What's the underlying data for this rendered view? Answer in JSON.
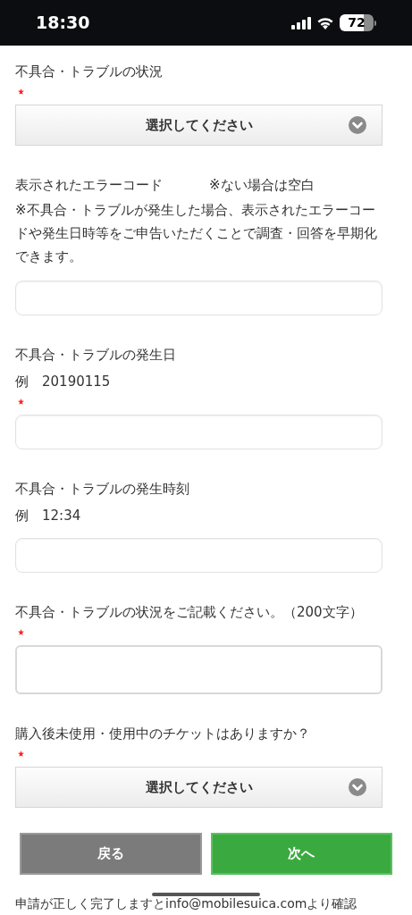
{
  "status_bar": {
    "time": "18:30",
    "battery": "72"
  },
  "fields": [
    {
      "kind": "select",
      "label": "不具合・トラブルの状況",
      "required": true,
      "value": "選択してください"
    },
    {
      "kind": "input",
      "label": "表示されたエラーコード",
      "side_note": "※ない場合は空白",
      "note": "※不具合・トラブルが発生した場合、表示されたエラーコードや発生日時等をご申告いただくことで調査・回答を早期化できます。",
      "required": false
    },
    {
      "kind": "input",
      "label": "不具合・トラブルの発生日",
      "example": "例　20190115",
      "required": true
    },
    {
      "kind": "input",
      "label": "不具合・トラブルの発生時刻",
      "example": "例　12:34",
      "required": false
    },
    {
      "kind": "textarea",
      "label": "不具合・トラブルの状況をご記載ください。（200文字）",
      "required": true
    },
    {
      "kind": "select",
      "label": "購入後未使用・使用中のチケットはありますか？",
      "required": true,
      "value": "選択してください"
    }
  ],
  "buttons": [
    {
      "kind": "back",
      "label": "戻る"
    },
    {
      "kind": "next",
      "label": "次へ"
    }
  ],
  "footer_text": "申請が正しく完了しますとinfo@mobilesuica.comより確認"
}
